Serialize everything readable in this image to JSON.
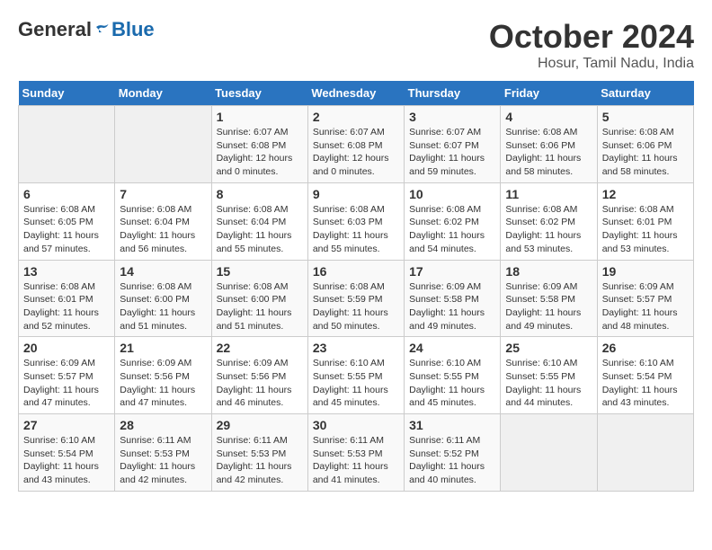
{
  "logo": {
    "general": "General",
    "blue": "Blue"
  },
  "title": "October 2024",
  "location": "Hosur, Tamil Nadu, India",
  "headers": [
    "Sunday",
    "Monday",
    "Tuesday",
    "Wednesday",
    "Thursday",
    "Friday",
    "Saturday"
  ],
  "weeks": [
    [
      {
        "day": "",
        "sunrise": "",
        "sunset": "",
        "daylight": ""
      },
      {
        "day": "",
        "sunrise": "",
        "sunset": "",
        "daylight": ""
      },
      {
        "day": "1",
        "sunrise": "Sunrise: 6:07 AM",
        "sunset": "Sunset: 6:08 PM",
        "daylight": "Daylight: 12 hours and 0 minutes."
      },
      {
        "day": "2",
        "sunrise": "Sunrise: 6:07 AM",
        "sunset": "Sunset: 6:08 PM",
        "daylight": "Daylight: 12 hours and 0 minutes."
      },
      {
        "day": "3",
        "sunrise": "Sunrise: 6:07 AM",
        "sunset": "Sunset: 6:07 PM",
        "daylight": "Daylight: 11 hours and 59 minutes."
      },
      {
        "day": "4",
        "sunrise": "Sunrise: 6:08 AM",
        "sunset": "Sunset: 6:06 PM",
        "daylight": "Daylight: 11 hours and 58 minutes."
      },
      {
        "day": "5",
        "sunrise": "Sunrise: 6:08 AM",
        "sunset": "Sunset: 6:06 PM",
        "daylight": "Daylight: 11 hours and 58 minutes."
      }
    ],
    [
      {
        "day": "6",
        "sunrise": "Sunrise: 6:08 AM",
        "sunset": "Sunset: 6:05 PM",
        "daylight": "Daylight: 11 hours and 57 minutes."
      },
      {
        "day": "7",
        "sunrise": "Sunrise: 6:08 AM",
        "sunset": "Sunset: 6:04 PM",
        "daylight": "Daylight: 11 hours and 56 minutes."
      },
      {
        "day": "8",
        "sunrise": "Sunrise: 6:08 AM",
        "sunset": "Sunset: 6:04 PM",
        "daylight": "Daylight: 11 hours and 55 minutes."
      },
      {
        "day": "9",
        "sunrise": "Sunrise: 6:08 AM",
        "sunset": "Sunset: 6:03 PM",
        "daylight": "Daylight: 11 hours and 55 minutes."
      },
      {
        "day": "10",
        "sunrise": "Sunrise: 6:08 AM",
        "sunset": "Sunset: 6:02 PM",
        "daylight": "Daylight: 11 hours and 54 minutes."
      },
      {
        "day": "11",
        "sunrise": "Sunrise: 6:08 AM",
        "sunset": "Sunset: 6:02 PM",
        "daylight": "Daylight: 11 hours and 53 minutes."
      },
      {
        "day": "12",
        "sunrise": "Sunrise: 6:08 AM",
        "sunset": "Sunset: 6:01 PM",
        "daylight": "Daylight: 11 hours and 53 minutes."
      }
    ],
    [
      {
        "day": "13",
        "sunrise": "Sunrise: 6:08 AM",
        "sunset": "Sunset: 6:01 PM",
        "daylight": "Daylight: 11 hours and 52 minutes."
      },
      {
        "day": "14",
        "sunrise": "Sunrise: 6:08 AM",
        "sunset": "Sunset: 6:00 PM",
        "daylight": "Daylight: 11 hours and 51 minutes."
      },
      {
        "day": "15",
        "sunrise": "Sunrise: 6:08 AM",
        "sunset": "Sunset: 6:00 PM",
        "daylight": "Daylight: 11 hours and 51 minutes."
      },
      {
        "day": "16",
        "sunrise": "Sunrise: 6:08 AM",
        "sunset": "Sunset: 5:59 PM",
        "daylight": "Daylight: 11 hours and 50 minutes."
      },
      {
        "day": "17",
        "sunrise": "Sunrise: 6:09 AM",
        "sunset": "Sunset: 5:58 PM",
        "daylight": "Daylight: 11 hours and 49 minutes."
      },
      {
        "day": "18",
        "sunrise": "Sunrise: 6:09 AM",
        "sunset": "Sunset: 5:58 PM",
        "daylight": "Daylight: 11 hours and 49 minutes."
      },
      {
        "day": "19",
        "sunrise": "Sunrise: 6:09 AM",
        "sunset": "Sunset: 5:57 PM",
        "daylight": "Daylight: 11 hours and 48 minutes."
      }
    ],
    [
      {
        "day": "20",
        "sunrise": "Sunrise: 6:09 AM",
        "sunset": "Sunset: 5:57 PM",
        "daylight": "Daylight: 11 hours and 47 minutes."
      },
      {
        "day": "21",
        "sunrise": "Sunrise: 6:09 AM",
        "sunset": "Sunset: 5:56 PM",
        "daylight": "Daylight: 11 hours and 47 minutes."
      },
      {
        "day": "22",
        "sunrise": "Sunrise: 6:09 AM",
        "sunset": "Sunset: 5:56 PM",
        "daylight": "Daylight: 11 hours and 46 minutes."
      },
      {
        "day": "23",
        "sunrise": "Sunrise: 6:10 AM",
        "sunset": "Sunset: 5:55 PM",
        "daylight": "Daylight: 11 hours and 45 minutes."
      },
      {
        "day": "24",
        "sunrise": "Sunrise: 6:10 AM",
        "sunset": "Sunset: 5:55 PM",
        "daylight": "Daylight: 11 hours and 45 minutes."
      },
      {
        "day": "25",
        "sunrise": "Sunrise: 6:10 AM",
        "sunset": "Sunset: 5:55 PM",
        "daylight": "Daylight: 11 hours and 44 minutes."
      },
      {
        "day": "26",
        "sunrise": "Sunrise: 6:10 AM",
        "sunset": "Sunset: 5:54 PM",
        "daylight": "Daylight: 11 hours and 43 minutes."
      }
    ],
    [
      {
        "day": "27",
        "sunrise": "Sunrise: 6:10 AM",
        "sunset": "Sunset: 5:54 PM",
        "daylight": "Daylight: 11 hours and 43 minutes."
      },
      {
        "day": "28",
        "sunrise": "Sunrise: 6:11 AM",
        "sunset": "Sunset: 5:53 PM",
        "daylight": "Daylight: 11 hours and 42 minutes."
      },
      {
        "day": "29",
        "sunrise": "Sunrise: 6:11 AM",
        "sunset": "Sunset: 5:53 PM",
        "daylight": "Daylight: 11 hours and 42 minutes."
      },
      {
        "day": "30",
        "sunrise": "Sunrise: 6:11 AM",
        "sunset": "Sunset: 5:53 PM",
        "daylight": "Daylight: 11 hours and 41 minutes."
      },
      {
        "day": "31",
        "sunrise": "Sunrise: 6:11 AM",
        "sunset": "Sunset: 5:52 PM",
        "daylight": "Daylight: 11 hours and 40 minutes."
      },
      {
        "day": "",
        "sunrise": "",
        "sunset": "",
        "daylight": ""
      },
      {
        "day": "",
        "sunrise": "",
        "sunset": "",
        "daylight": ""
      }
    ]
  ]
}
